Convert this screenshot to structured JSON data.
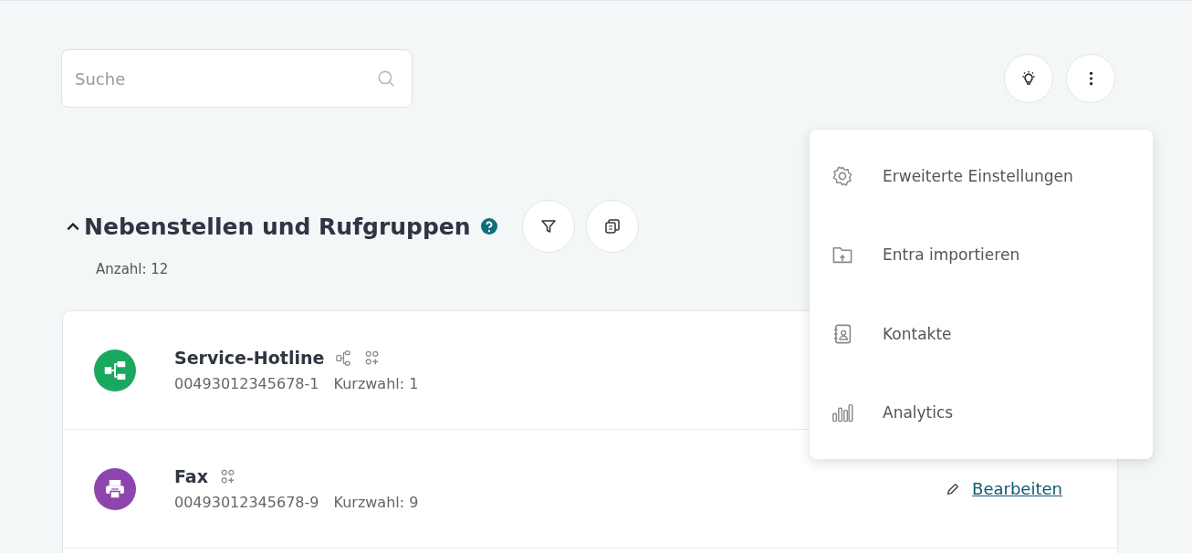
{
  "search": {
    "placeholder": "Suche"
  },
  "toolbar": [
    {
      "kind": "bulb"
    },
    {
      "kind": "more"
    }
  ],
  "section": {
    "title": "Nebenstellen und Rufgruppen",
    "expanded": true,
    "count": "Anzahl: 12",
    "tools": [
      {
        "kind": "filter"
      },
      {
        "kind": "copy"
      }
    ]
  },
  "rows": [
    {
      "name": "Service-Hotline",
      "number": "00493012345678-1",
      "shortcut": "Kurzwahl: 1",
      "kind": "group",
      "color": "#1aa85f",
      "badges": [
        {
          "kind": "flow"
        },
        {
          "kind": "group-add"
        }
      ]
    },
    {
      "name": "Fax",
      "number": "00493012345678-9",
      "shortcut": "Kurzwahl: 9",
      "kind": "fax",
      "color": "#8e44ad",
      "badges": [
        {
          "kind": "group-add"
        }
      ],
      "action": "Bearbeiten"
    }
  ],
  "menu": [
    {
      "kind": "settings",
      "label": "Erweiterte Einstellungen"
    },
    {
      "kind": "import",
      "label": "Entra importieren"
    },
    {
      "kind": "contacts",
      "label": "Kontakte"
    },
    {
      "kind": "analytics",
      "label": "Analytics"
    }
  ]
}
